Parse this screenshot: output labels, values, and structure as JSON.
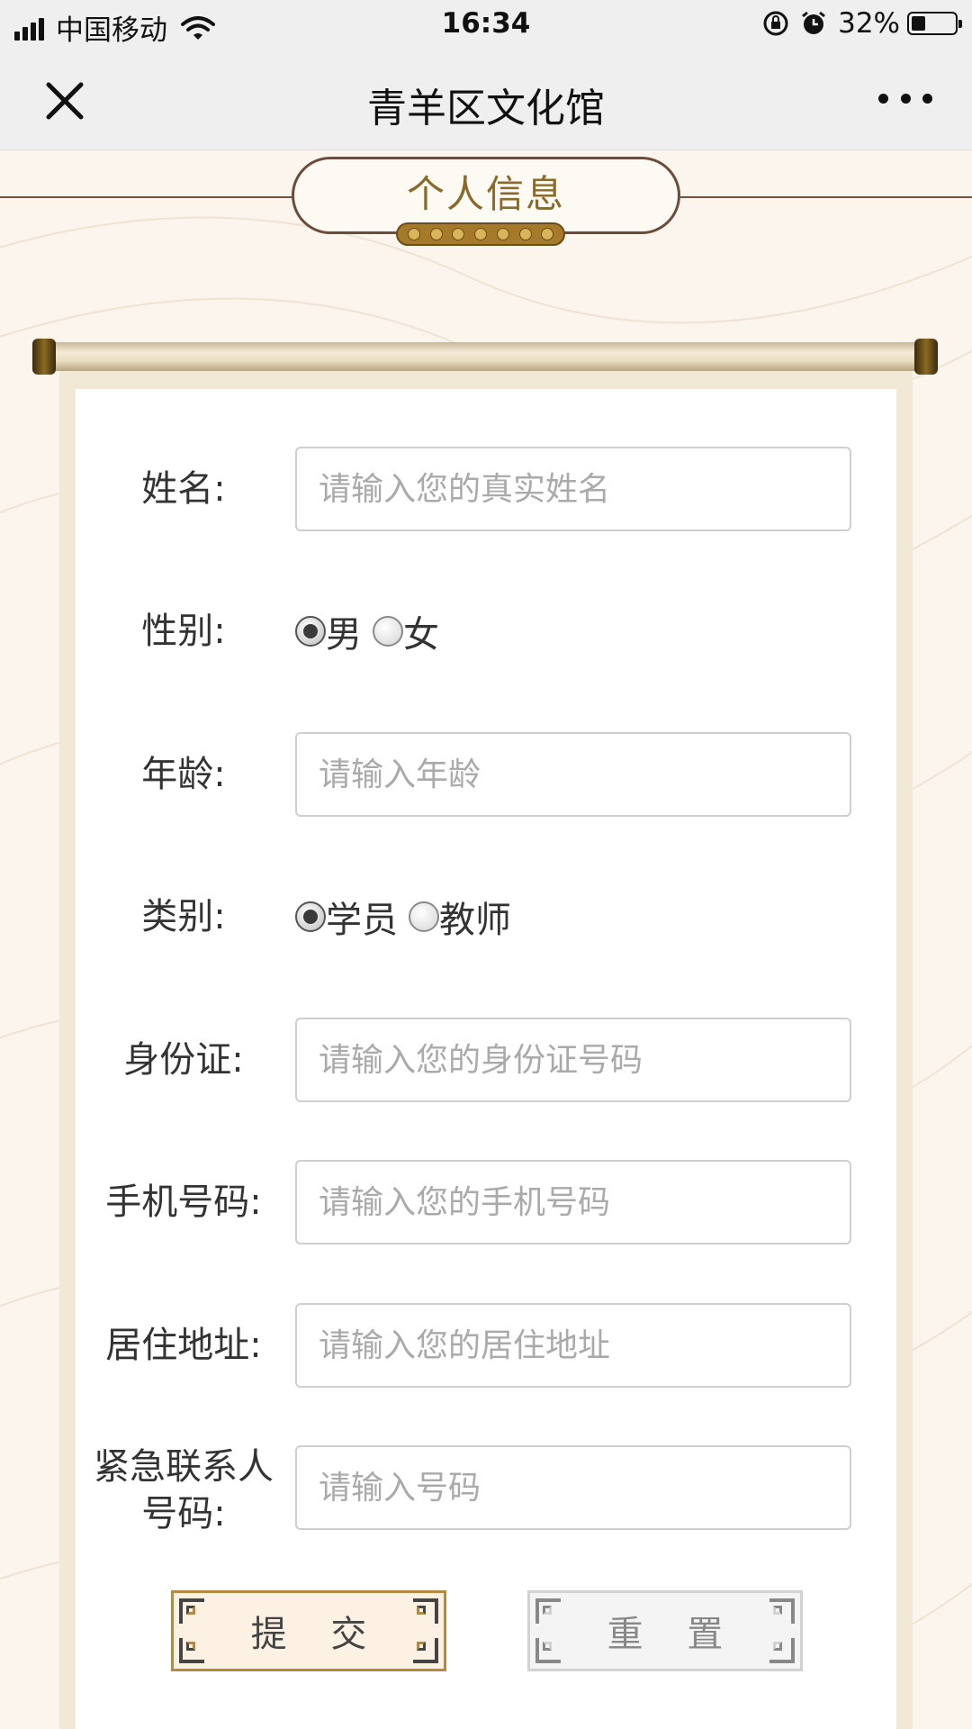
{
  "status_bar": {
    "carrier": "中国移动",
    "time": "16:34",
    "battery": "32%",
    "battery_level": 0.32
  },
  "nav": {
    "title": "青羊区文化馆"
  },
  "section": {
    "title": "个人信息"
  },
  "form": {
    "name": {
      "label": "姓名:",
      "placeholder": "请输入您的真实姓名"
    },
    "gender": {
      "label": "性别:",
      "options": [
        "男",
        "女"
      ],
      "selected": "男"
    },
    "age": {
      "label": "年龄:",
      "placeholder": "请输入年龄"
    },
    "category": {
      "label": "类别:",
      "options": [
        "学员",
        "教师"
      ],
      "selected": "学员"
    },
    "id_card": {
      "label": "身份证:",
      "placeholder": "请输入您的身份证号码"
    },
    "phone": {
      "label": "手机号码:",
      "placeholder": "请输入您的手机号码"
    },
    "address": {
      "label": "居住地址:",
      "placeholder": "请输入您的居住地址"
    },
    "emergency": {
      "label_line1": "紧急联系人",
      "label_line2": "号码:",
      "placeholder": "请输入号码"
    }
  },
  "buttons": {
    "submit": "提 交",
    "reset": "重 置"
  }
}
